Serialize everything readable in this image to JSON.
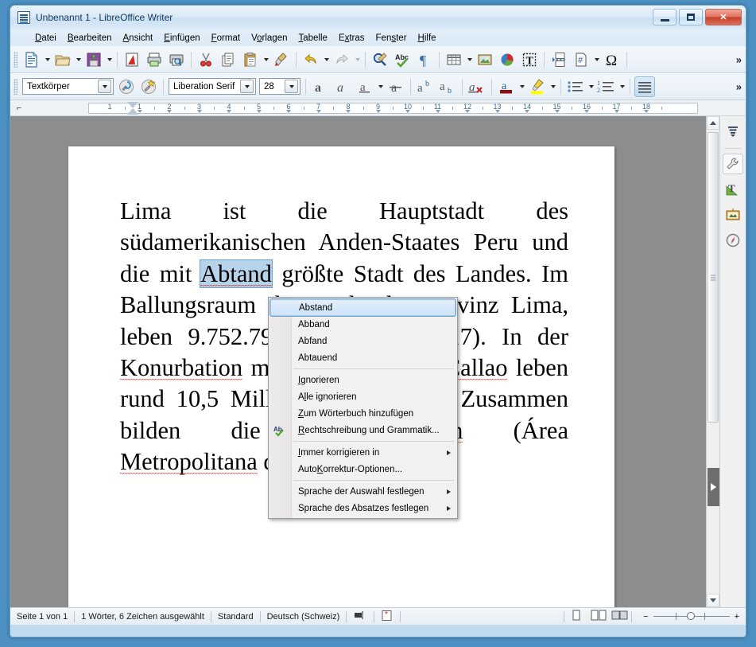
{
  "window": {
    "title": "Unbenannt 1 - LibreOffice Writer",
    "icon": "writer-document-icon",
    "controls": {
      "minimize": "minimize",
      "maximize": "maximize",
      "close": "close"
    }
  },
  "menubar": {
    "items": [
      {
        "label": "Datei",
        "accel": "D"
      },
      {
        "label": "Bearbeiten",
        "accel": "B"
      },
      {
        "label": "Ansicht",
        "accel": "A"
      },
      {
        "label": "Einfügen",
        "accel": "E"
      },
      {
        "label": "Format",
        "accel": "F"
      },
      {
        "label": "Vorlagen",
        "accel": "o"
      },
      {
        "label": "Tabelle",
        "accel": "T"
      },
      {
        "label": "Extras",
        "accel": "x"
      },
      {
        "label": "Fenster",
        "accel": "s"
      },
      {
        "label": "Hilfe",
        "accel": "H"
      }
    ]
  },
  "toolbar_standard": {
    "overflow": "»",
    "buttons": [
      "new-document-icon",
      "open-document-icon",
      "save-document-icon",
      "export-pdf-icon",
      "print-icon",
      "print-preview-icon",
      "cut-icon",
      "copy-icon",
      "paste-icon",
      "clone-formatting-icon",
      "undo-icon",
      "redo-icon",
      "find-replace-icon",
      "spelling-icon",
      "formatting-marks-icon",
      "insert-table-icon",
      "insert-image-icon",
      "insert-chart-icon",
      "insert-text-box-icon",
      "page-break-icon",
      "insert-field-icon",
      "special-character-icon"
    ]
  },
  "toolbar_formatting": {
    "overflow": "»",
    "paragraph_style": "Textkörper",
    "font_name": "Liberation Serif",
    "font_size": "28",
    "buttons": [
      "update-style-icon",
      "new-style-icon",
      "bold-icon",
      "italic-icon",
      "underline-icon",
      "strikethrough-icon",
      "superscript-icon",
      "subscript-icon",
      "clear-formatting-icon",
      "font-color-icon",
      "highlight-color-icon",
      "unordered-list-icon",
      "ordered-list-icon",
      "align-justified-icon"
    ],
    "font_color": "#8c1010",
    "highlight_color": "#ffff00",
    "active_button": "align-justified-icon"
  },
  "ruler": {
    "tab_selector_icon": "tab-left-icon",
    "labels": [
      "1",
      "1",
      "2",
      "3",
      "4",
      "5",
      "6",
      "7",
      "8",
      "9",
      "10",
      "11",
      "12",
      "13",
      "14",
      "15",
      "16",
      "17",
      "18"
    ]
  },
  "document": {
    "segments": [
      {
        "text": "Lima ist die Hauptstadt des südamerikanischen Anden-Staates Peru und die mit ",
        "style": "normal"
      },
      {
        "text": "Abtand",
        "style": "selected-misspelled"
      },
      {
        "text": " größte Stadt des Landes. Im ",
        "style": "normal"
      },
      {
        "text": "Ballungsraum",
        "style": "normal"
      },
      {
        "text": " der Stadt, der Provinz Lima, leben 9.752.792 Menschen (2017). In der ",
        "style": "normal"
      },
      {
        "text": "Konurbation",
        "style": "misspelled"
      },
      {
        "text": " mit der Hafenstadt ",
        "style": "normal"
      },
      {
        "text": "Callao",
        "style": "misspelled"
      },
      {
        "text": " leben rund 10,5 Millionen Einwohner. Zusammen bilden die ",
        "style": "normal"
      },
      {
        "text": "Metropolregion",
        "style": "misspelled"
      },
      {
        "text": " (Área ",
        "style": "normal"
      },
      {
        "text": "Metropolitana",
        "style": "misspelled"
      },
      {
        "text": " de Lima).",
        "style": "normal"
      }
    ],
    "selected_word": "Abtand"
  },
  "context_menu": {
    "suggestions": [
      "Abstand",
      "Abband",
      "Abfand",
      "Abtauend"
    ],
    "highlighted": "Abstand",
    "actions": [
      {
        "label": "Ignorieren",
        "accel": "I",
        "submenu": false
      },
      {
        "label": "Alle ignorieren",
        "accel": "l",
        "submenu": false
      },
      {
        "label": "Zum Wörterbuch hinzufügen",
        "accel": "Z",
        "submenu": false
      },
      {
        "label": "Rechtschreibung und Grammatik...",
        "accel": "R",
        "submenu": false,
        "icon": "spellcheck-icon"
      },
      {
        "label": "Immer korrigieren in",
        "accel": "I",
        "submenu": true
      },
      {
        "label": "AutoKorrektur-Optionen...",
        "accel": "K",
        "submenu": false
      },
      {
        "label": "Sprache der Auswahl festlegen",
        "accel": "",
        "submenu": true
      },
      {
        "label": "Sprache des Absatzes festlegen",
        "accel": "g",
        "submenu": true
      }
    ]
  },
  "sidebar": {
    "items": [
      {
        "name": "sidebar-settings",
        "icon": "sidebar-settings-icon"
      },
      {
        "name": "properties",
        "icon": "wrench-icon"
      },
      {
        "name": "styles",
        "icon": "styles-icon"
      },
      {
        "name": "gallery",
        "icon": "gallery-icon"
      },
      {
        "name": "navigator",
        "icon": "navigator-icon"
      }
    ]
  },
  "statusbar": {
    "page": "Seite 1 von 1",
    "words": "1 Wörter, 6 Zeichen ausgewählt",
    "page_style": "Standard",
    "language": "Deutsch (Schweiz)",
    "insert_mode_icon": "selection-mode-icon",
    "save_state_icon": "unsaved-changes-icon",
    "view_icons": [
      "single-page-view-icon",
      "multi-page-view-icon",
      "book-view-icon"
    ],
    "zoom_out": "−",
    "zoom_in": "+"
  }
}
